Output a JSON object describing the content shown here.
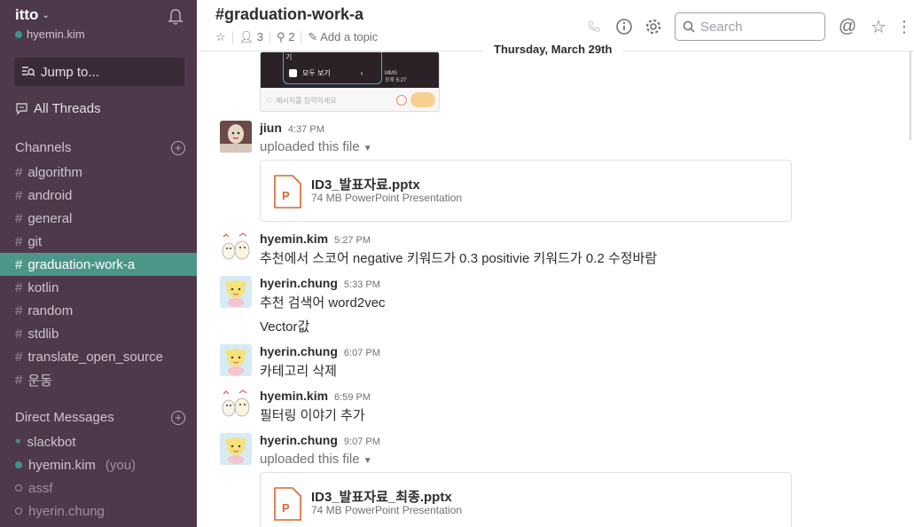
{
  "workspace": {
    "name": "itto",
    "user": "hyemin.kim"
  },
  "sidebar": {
    "jump_label": "Jump to...",
    "all_threads": "All Threads",
    "channels_title": "Channels",
    "channels": [
      "algorithm",
      "android",
      "general",
      "git",
      "graduation-work-a",
      "kotlin",
      "random",
      "stdlib",
      "translate_open_source",
      "운동"
    ],
    "active_channel": "graduation-work-a",
    "dm_title": "Direct Messages",
    "dms": [
      {
        "name": "slackbot",
        "status": "bot"
      },
      {
        "name": "hyemin.kim",
        "suffix": "(you)",
        "status": "online"
      },
      {
        "name": "assf",
        "status": "offline"
      },
      {
        "name": "hyerin.chung",
        "status": "offline"
      }
    ]
  },
  "header": {
    "title": "#graduation-work-a",
    "members": "3",
    "pins": "2",
    "topic": "Add a topic",
    "search_placeholder": "Search"
  },
  "date_divider": "Thursday, March 29th",
  "preview": {
    "button": "모두 보기",
    "mms": "MMS",
    "ampm": "오후 5:27",
    "input_placeholder": "메시지를 입력하세요"
  },
  "messages": [
    {
      "author": "jiun",
      "time": "4:37 PM",
      "uploaded": "uploaded this file",
      "file": {
        "name": "ID3_발표자료.pptx",
        "meta": "74 MB PowerPoint Presentation"
      }
    },
    {
      "author": "hyemin.kim",
      "time": "5:27 PM",
      "text": "추천에서 스코어 negative 키워드가 0.3 positivie 키워드가 0.2 수정바람"
    },
    {
      "author": "hyerin.chung",
      "time": "5:33 PM",
      "text": "추천 검색어 word2vec",
      "text2": "Vector값"
    },
    {
      "author": "hyerin.chung",
      "time": "6:07 PM",
      "text": "카테고리 삭제"
    },
    {
      "author": "hyemin.kim",
      "time": "6:59 PM",
      "text": "필터링 이야기 추가"
    },
    {
      "author": "hyerin.chung",
      "time": "9:07 PM",
      "uploaded": "uploaded this file",
      "file": {
        "name": "ID3_발표자료_최종.pptx",
        "meta": "74 MB PowerPoint Presentation"
      }
    }
  ],
  "colors": {
    "sidebar_bg": "#4d394b",
    "active_channel": "#4c9689",
    "file_icon": "#e0632b"
  }
}
